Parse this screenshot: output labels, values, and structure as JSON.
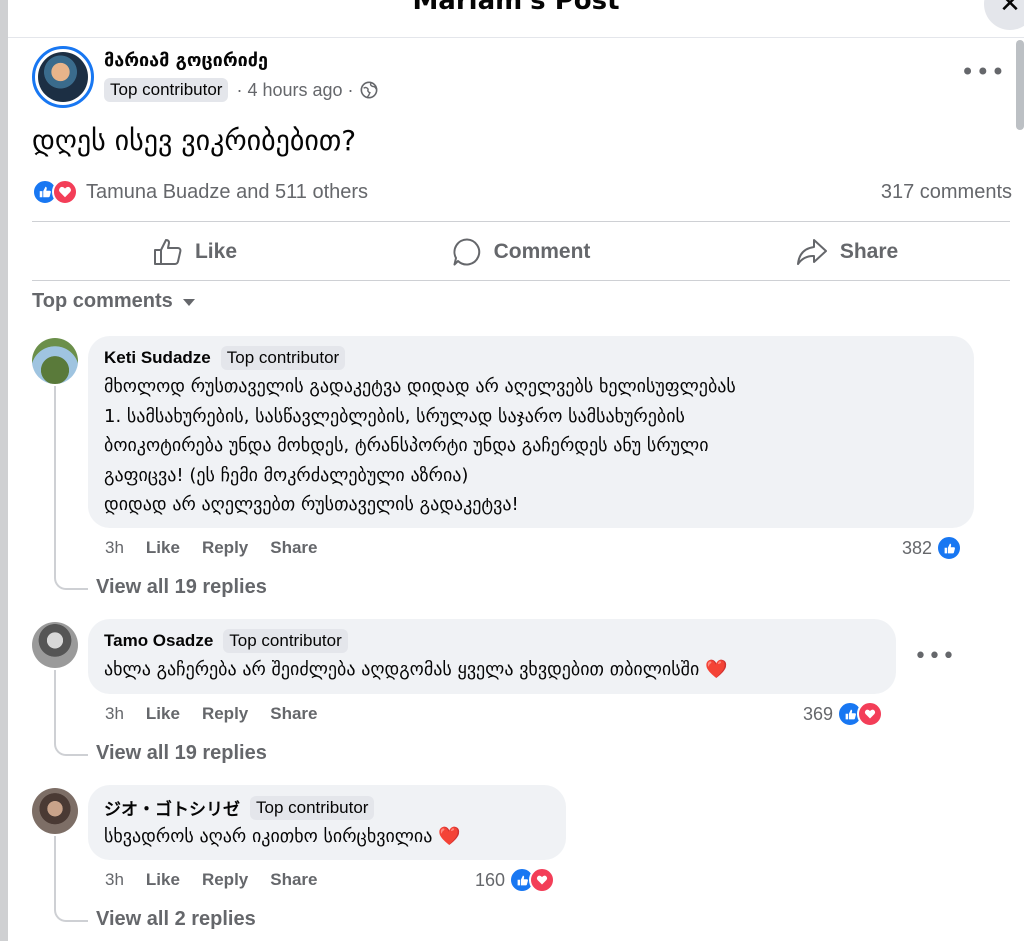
{
  "modal": {
    "title": "Mariam's Post",
    "close_icon": "close-icon"
  },
  "post": {
    "author": "მარიამ გოცირიძე",
    "badge": "Top contributor",
    "time": "· 4 hours ago ·",
    "audience_icon": "globe-icon",
    "text": "დღეს ისევ ვიკრიბებით?",
    "reactions": {
      "names": "Tamuna Buadze and 511 others",
      "comments": "317 comments"
    },
    "actions": {
      "like": "Like",
      "comment": "Comment",
      "share": "Share"
    }
  },
  "comments_section": {
    "filter_label": "Top comments",
    "comments": [
      {
        "name": "Keti Sudadze",
        "badge": "Top contributor",
        "lines": [
          "მხოლოდ რუსთაველის გადაკეტვა დიდად არ აღელვებს ხელისუფლებას",
          "1. სამსახურების, სასწავლებლების, სრულად საჯარო სამსახურების",
          "ბოიკოტირება უნდა მოხდეს, ტრანსპორტი უნდა გაჩერდეს ანუ სრული",
          "გაფიცვა! (ეს ჩემი მოკრძალებული აზრია)",
          "დიდად არ აღელვებთ რუსთაველის გადაკეტვა!"
        ],
        "time": "3h",
        "like": "Like",
        "reply": "Reply",
        "share": "Share",
        "count": "382",
        "replies": "View all 19 replies"
      },
      {
        "name": "Tamo Osadze",
        "badge": "Top contributor",
        "lines": [
          "ახლა გაჩერება არ შეიძლება აღდგომას ყველა ვხვდებით თბილისში"
        ],
        "emoji": "❤️",
        "time": "3h",
        "like": "Like",
        "reply": "Reply",
        "share": "Share",
        "count": "369",
        "replies": "View all 19 replies"
      },
      {
        "name": "ジオ・ゴトシリゼ",
        "badge": "Top contributor",
        "lines": [
          "სხვადროს აღარ იკითხო სირცხვილია"
        ],
        "emoji": "❤️",
        "time": "3h",
        "like": "Like",
        "reply": "Reply",
        "share": "Share",
        "count": "160",
        "replies": "View all 2 replies"
      }
    ]
  },
  "colors": {
    "accent": "#1877f2",
    "love": "#f33e58",
    "muted": "#65676b",
    "bubble": "#f0f2f5"
  }
}
